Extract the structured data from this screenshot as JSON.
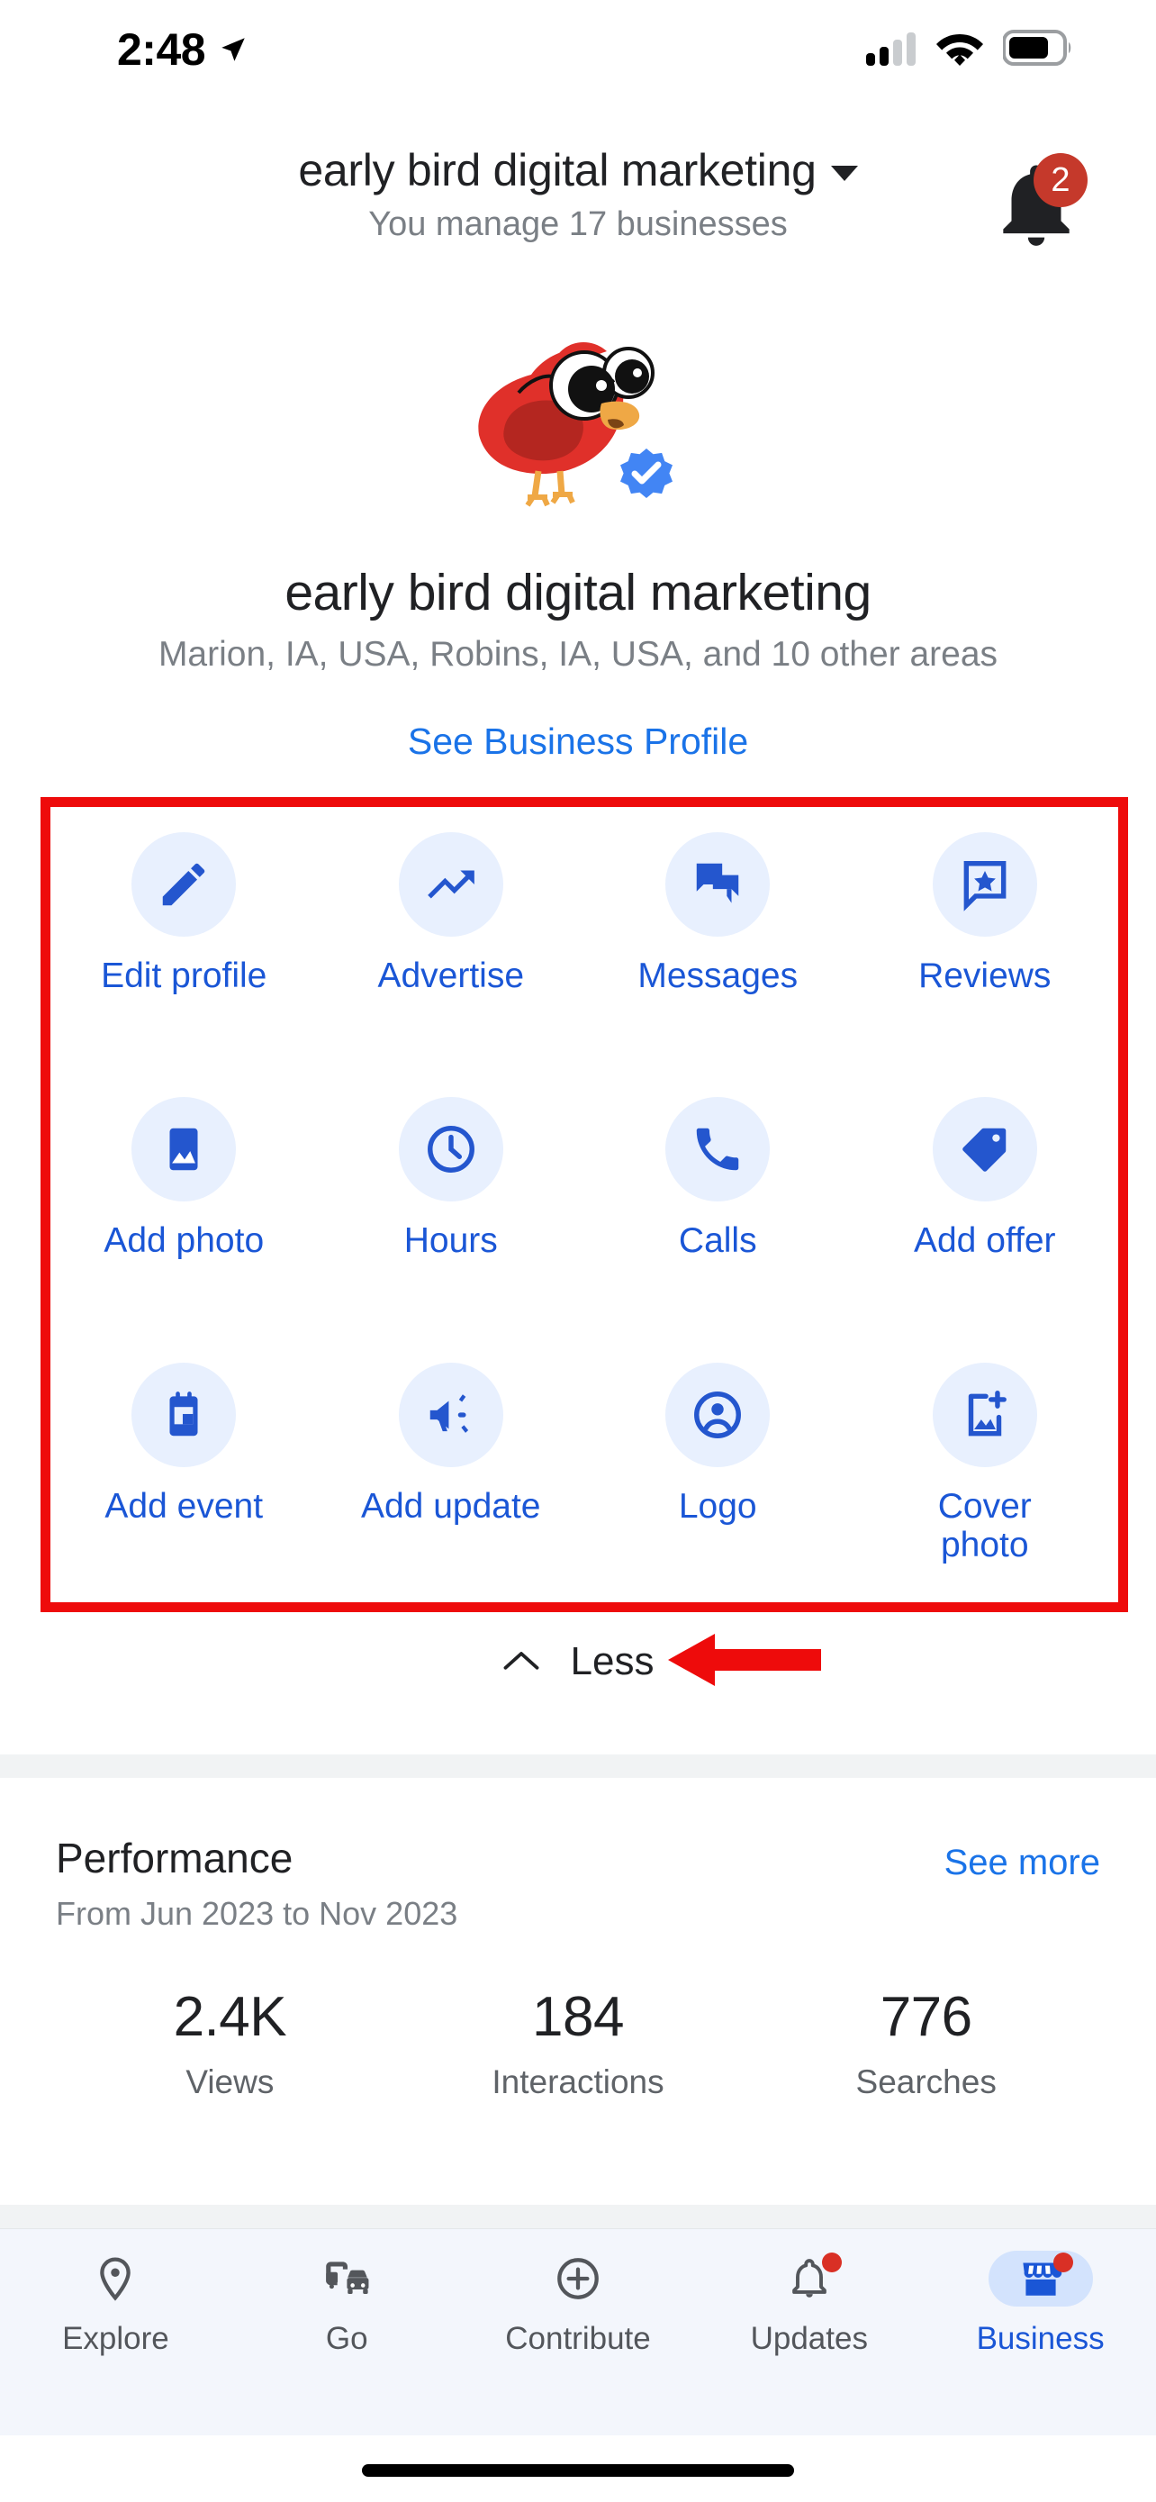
{
  "status_bar": {
    "time": "2:48",
    "location_icon": "location-arrow-icon",
    "signal_icon": "cellular-signal-icon",
    "signal_bars_filled": 2,
    "signal_bars_total": 4,
    "wifi_icon": "wifi-icon",
    "battery_icon": "battery-icon",
    "battery_level_percent": 70
  },
  "header": {
    "title": "early bird digital marketing",
    "dropdown_icon": "chevron-down-icon",
    "subtitle": "You manage 17 businesses",
    "bell_icon": "notification-bell-icon",
    "bell_badge": "2"
  },
  "profile": {
    "avatar_icon": "red-bird-avatar",
    "verified_icon": "verified-badge-icon",
    "business_name": "early bird digital marketing",
    "service_areas": "Marion, IA, USA, Robins, IA, USA, and 10 other areas",
    "see_profile_link": "See Business Profile"
  },
  "actions": {
    "items": [
      {
        "label": "Edit profile",
        "icon": "pencil-icon"
      },
      {
        "label": "Advertise",
        "icon": "trending-up-icon"
      },
      {
        "label": "Messages",
        "icon": "chat-bubbles-icon"
      },
      {
        "label": "Reviews",
        "icon": "review-star-bubble-icon"
      },
      {
        "label": "Add photo",
        "icon": "image-icon"
      },
      {
        "label": "Hours",
        "icon": "clock-icon"
      },
      {
        "label": "Calls",
        "icon": "phone-icon"
      },
      {
        "label": "Add offer",
        "icon": "tag-icon"
      },
      {
        "label": "Add event",
        "icon": "calendar-icon"
      },
      {
        "label": "Add\nupdate",
        "icon": "megaphone-icon"
      },
      {
        "label": "Logo",
        "icon": "account-circle-icon"
      },
      {
        "label": "Cover\nphoto",
        "icon": "add-image-icon"
      }
    ],
    "toggle_label": "Less",
    "toggle_icon": "chevron-up-icon"
  },
  "annotations": {
    "highlight_box_color": "#EE0B0B",
    "arrow_color": "#EE0B0B",
    "arrow_icon": "left-arrow-annotation"
  },
  "performance": {
    "title": "Performance",
    "date_range": "From Jun 2023 to Nov 2023",
    "see_more_label": "See more",
    "stats": [
      {
        "value": "2.4K",
        "label": "Views"
      },
      {
        "value": "184",
        "label": "Interactions"
      },
      {
        "value": "776",
        "label": "Searches"
      }
    ]
  },
  "bottom_nav": {
    "items": [
      {
        "label": "Explore",
        "icon": "location-pin-icon",
        "active": false,
        "badge": false
      },
      {
        "label": "Go",
        "icon": "transit-car-icon",
        "active": false,
        "badge": false
      },
      {
        "label": "Contribute",
        "icon": "plus-circle-icon",
        "active": false,
        "badge": false
      },
      {
        "label": "Updates",
        "icon": "bell-icon",
        "active": false,
        "badge": true
      },
      {
        "label": "Business",
        "icon": "storefront-icon",
        "active": true,
        "badge": true
      }
    ],
    "active_color": "#1a56d6",
    "active_pill_color": "#D3E3FD"
  }
}
